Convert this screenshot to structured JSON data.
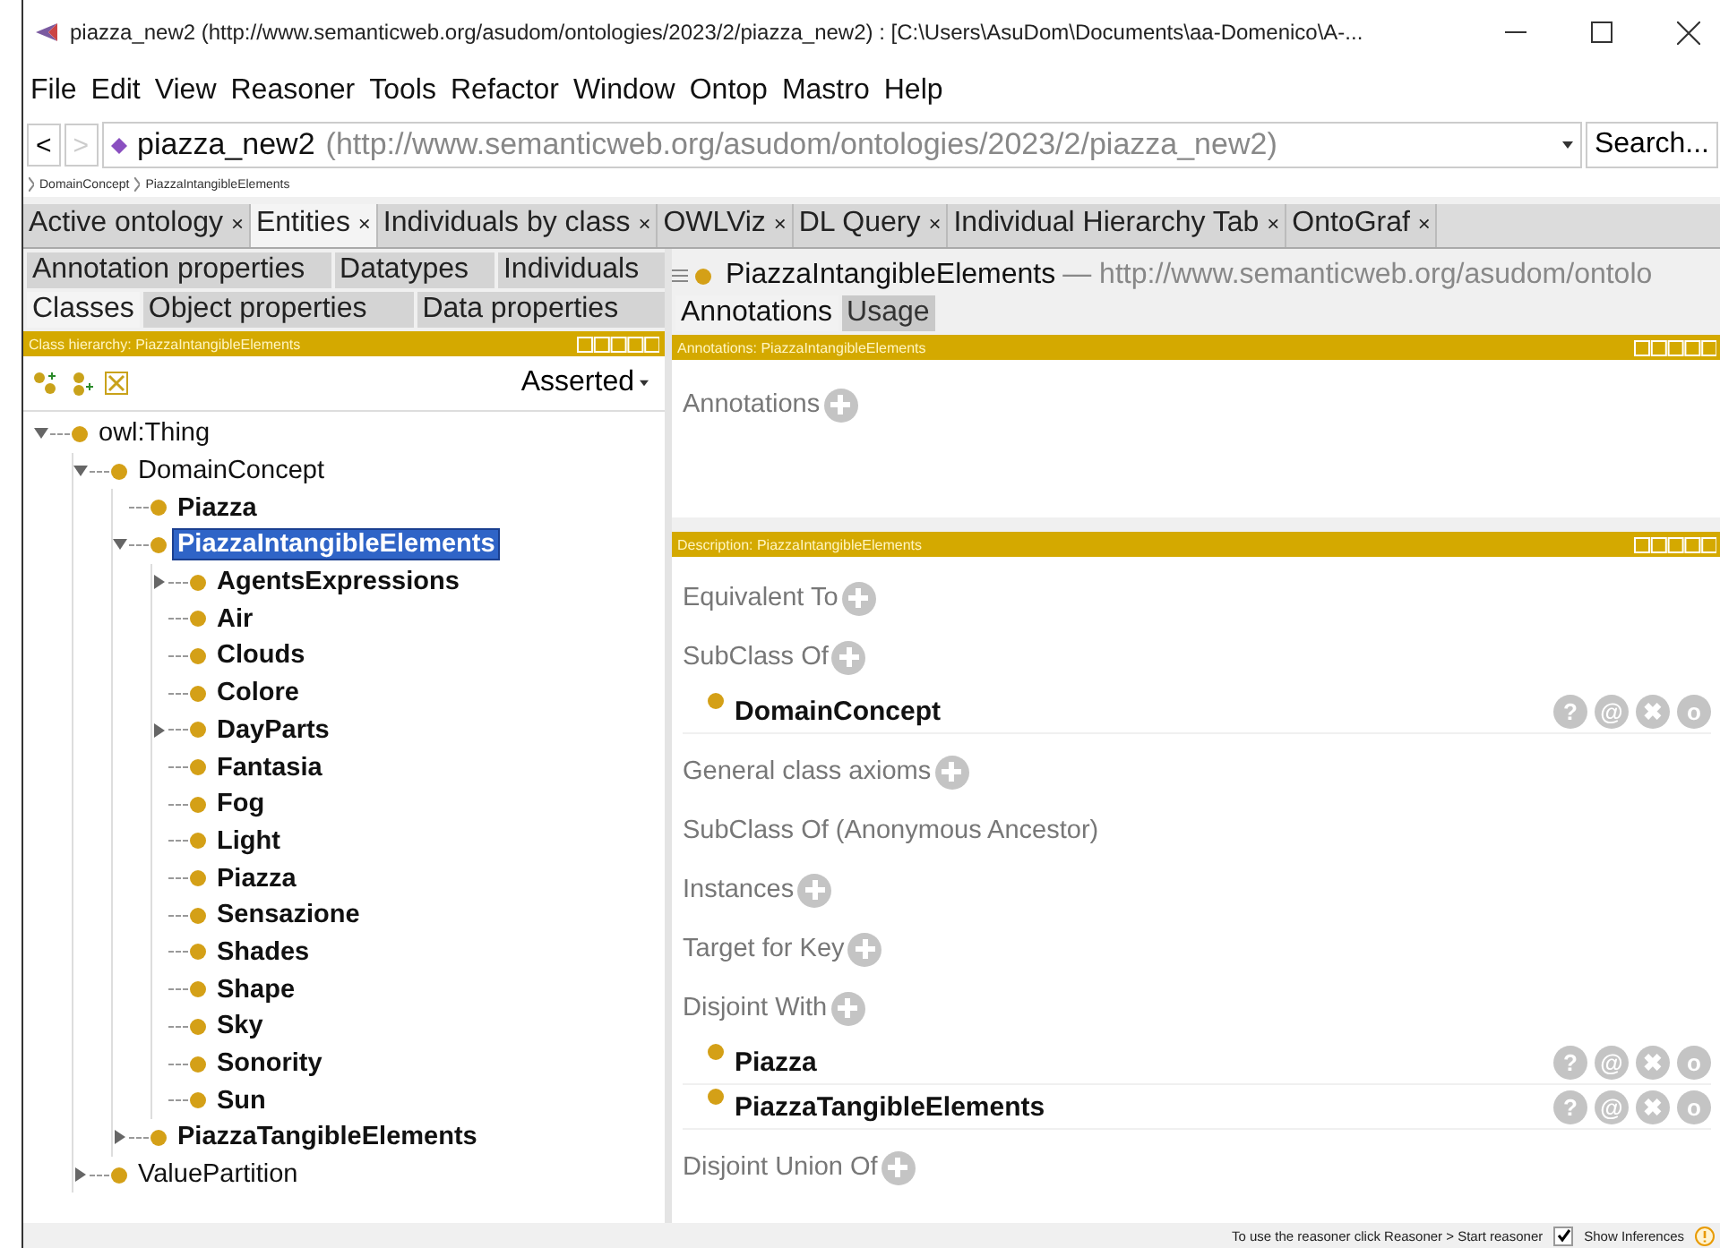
{
  "window": {
    "title": "piazza_new2 (http://www.semanticweb.org/asudom/ontologies/2023/2/piazza_new2)  : [C:\\Users\\AsuDom\\Documents\\aa-Domenico\\A-..."
  },
  "menu": [
    "File",
    "Edit",
    "View",
    "Reasoner",
    "Tools",
    "Refactor",
    "Window",
    "Ontop",
    "Mastro",
    "Help"
  ],
  "address_bar": {
    "back": {
      "label": "<",
      "disabled": false
    },
    "forward": {
      "label": ">",
      "disabled": true
    },
    "name": "piazza_new2",
    "iri": "(http://www.semanticweb.org/asudom/ontologies/2023/2/piazza_new2)",
    "search": "Search..."
  },
  "breadcrumb": [
    "DomainConcept",
    "PiazzaIntangibleElements"
  ],
  "tabs": [
    {
      "label": "Active ontology",
      "close": "×",
      "selected": false
    },
    {
      "label": "Entities",
      "close": "×",
      "selected": true
    },
    {
      "label": "Individuals by class",
      "close": "×",
      "selected": false
    },
    {
      "label": "OWLViz",
      "close": "×",
      "selected": false
    },
    {
      "label": "DL Query",
      "close": "×",
      "selected": false
    },
    {
      "label": "Individual Hierarchy Tab",
      "close": "×",
      "selected": false
    },
    {
      "label": "OntoGraf",
      "close": "×",
      "selected": false
    }
  ],
  "entity_tabs": [
    [
      {
        "label": "Annotation properties",
        "selected": false
      },
      {
        "label": "Datatypes",
        "selected": false
      },
      {
        "label": "Individuals",
        "selected": false
      }
    ],
    [
      {
        "label": "Classes",
        "selected": true
      },
      {
        "label": "Object properties",
        "selected": false
      },
      {
        "label": "Data properties",
        "selected": false
      }
    ]
  ],
  "class_hierarchy": {
    "header": "Class hierarchy: PiazzaIntangibleElements",
    "mode": "Asserted",
    "tree": [
      {
        "label": "owl:Thing",
        "bold": false,
        "selected": false,
        "expanded": true,
        "children": [
          {
            "label": "DomainConcept",
            "bold": false,
            "selected": false,
            "expanded": true,
            "children": [
              {
                "label": "Piazza",
                "bold": true,
                "selected": false
              },
              {
                "label": "PiazzaIntangibleElements",
                "bold": true,
                "selected": true,
                "expanded": true,
                "children": [
                  {
                    "label": "AgentsExpressions",
                    "bold": true,
                    "selected": false,
                    "expanded": false
                  },
                  {
                    "label": "Air",
                    "bold": true,
                    "selected": false
                  },
                  {
                    "label": "Clouds",
                    "bold": true,
                    "selected": false
                  },
                  {
                    "label": "Colore",
                    "bold": true,
                    "selected": false
                  },
                  {
                    "label": "DayParts",
                    "bold": true,
                    "selected": false,
                    "expanded": false
                  },
                  {
                    "label": "Fantasia",
                    "bold": true,
                    "selected": false
                  },
                  {
                    "label": "Fog",
                    "bold": true,
                    "selected": false
                  },
                  {
                    "label": "Light",
                    "bold": true,
                    "selected": false
                  },
                  {
                    "label": "Piazza",
                    "bold": true,
                    "selected": false
                  },
                  {
                    "label": "Sensazione",
                    "bold": true,
                    "selected": false
                  },
                  {
                    "label": "Shades",
                    "bold": true,
                    "selected": false
                  },
                  {
                    "label": "Shape",
                    "bold": true,
                    "selected": false
                  },
                  {
                    "label": "Sky",
                    "bold": true,
                    "selected": false
                  },
                  {
                    "label": "Sonority",
                    "bold": true,
                    "selected": false
                  },
                  {
                    "label": "Sun",
                    "bold": true,
                    "selected": false
                  }
                ]
              },
              {
                "label": "PiazzaTangibleElements",
                "bold": true,
                "selected": false,
                "expanded": false
              }
            ]
          },
          {
            "label": "ValuePartition",
            "bold": false,
            "selected": false,
            "expanded": false
          }
        ]
      }
    ]
  },
  "entity": {
    "name": "PiazzaIntangibleElements",
    "iri": "— http://www.semanticweb.org/asudom/ontolo"
  },
  "view_tabs": [
    {
      "label": "Annotations",
      "selected": true
    },
    {
      "label": "Usage",
      "selected": false
    }
  ],
  "annotations": {
    "header": "Annotations: PiazzaIntangibleElements",
    "title": "Annotations"
  },
  "description": {
    "header": "Description: PiazzaIntangibleElements",
    "sections": [
      {
        "title": "Equivalent To"
      },
      {
        "title": "SubClass Of",
        "items": [
          {
            "label": "DomainConcept",
            "actions": [
              "?",
              "@",
              "✖",
              "o"
            ]
          }
        ]
      },
      {
        "title": "General class axioms"
      },
      {
        "title": "SubClass Of (Anonymous Ancestor)",
        "addable": false
      },
      {
        "title": "Instances"
      },
      {
        "title": "Target for Key"
      },
      {
        "title": "Disjoint With",
        "items": [
          {
            "label": "Piazza",
            "actions": [
              "?",
              "@",
              "✖",
              "o"
            ]
          },
          {
            "label": "PiazzaTangibleElements",
            "actions": [
              "?",
              "@",
              "✖",
              "o"
            ]
          }
        ]
      },
      {
        "title": "Disjoint Union Of"
      }
    ]
  },
  "status_bar": {
    "message": "To use the reasoner click Reasoner > Start reasoner",
    "show_inferences": {
      "label": "Show Inferences",
      "checked": true
    }
  }
}
